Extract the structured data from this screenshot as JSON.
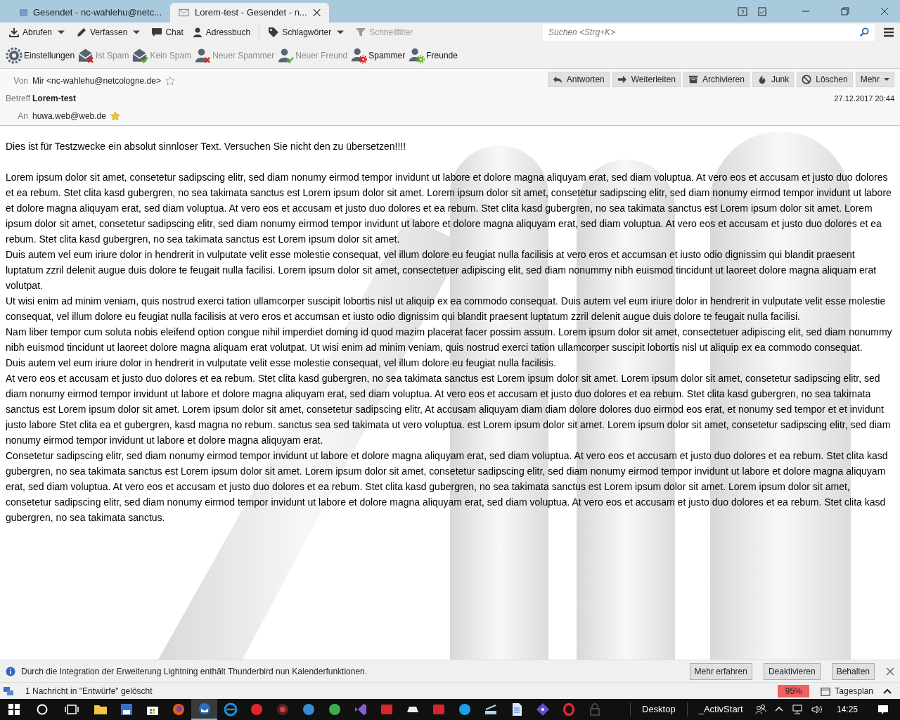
{
  "tabs": [
    {
      "label": "Gesendet - nc-wahlehu@netc...",
      "selected": false,
      "kind": "folder"
    },
    {
      "label": "Lorem-test - Gesendet - n...",
      "selected": true,
      "kind": "message"
    }
  ],
  "main_toolbar": [
    {
      "label": "Abrufen",
      "kind": "download",
      "dropdown": true,
      "disabled": false
    },
    {
      "label": "Verfassen",
      "kind": "pencil",
      "dropdown": true,
      "disabled": false
    },
    {
      "label": "Chat",
      "kind": "chat",
      "dropdown": false,
      "disabled": false
    },
    {
      "label": "Adressbuch",
      "kind": "person",
      "dropdown": false,
      "disabled": false
    },
    {
      "label": "Schlagwörter",
      "kind": "tag",
      "dropdown": true,
      "disabled": false
    },
    {
      "label": "Schnellfilter",
      "kind": "filter",
      "dropdown": false,
      "disabled": true
    }
  ],
  "search": {
    "placeholder": "Suchen <Strg+K>"
  },
  "spam_toolbar": [
    {
      "label": "Einstellungen",
      "kind": "gear",
      "disabled": false
    },
    {
      "label": "Ist Spam",
      "kind": "mail-x",
      "disabled": true
    },
    {
      "label": "Kein Spam",
      "kind": "mail-check",
      "disabled": true
    },
    {
      "label": "Neuer Spammer",
      "kind": "person-x",
      "disabled": true
    },
    {
      "label": "Neuer Freund",
      "kind": "person-check",
      "disabled": true
    },
    {
      "label": "Spammer",
      "kind": "person-gear-red",
      "disabled": false
    },
    {
      "label": "Freunde",
      "kind": "person-gear-green",
      "disabled": false
    }
  ],
  "header": {
    "from_label": "Von",
    "from": "Mir <nc-wahlehu@netcologne.de>",
    "from_starred": false,
    "subject_label": "Betreff",
    "subject": "Lorem-test",
    "to_label": "An",
    "to": "huwa.web@web.de",
    "to_starred": true,
    "date": "27.12.2017 20:44",
    "actions": [
      {
        "label": "Antworten",
        "kind": "reply"
      },
      {
        "label": "Weiterleiten",
        "kind": "forward"
      },
      {
        "label": "Archivieren",
        "kind": "archive"
      },
      {
        "label": "Junk",
        "kind": "junk"
      },
      {
        "label": "Löschen",
        "kind": "delete"
      },
      {
        "label": "Mehr",
        "kind": "more"
      }
    ]
  },
  "body": {
    "intro": "Dies ist für Testzwecke ein absolut sinnloser Text. Versuchen Sie nicht den zu übersetzen!!!!",
    "paragraphs": [
      "Lorem ipsum dolor sit amet, consetetur sadipscing elitr, sed diam nonumy eirmod tempor invidunt ut labore et dolore magna aliquyam erat, sed diam voluptua. At vero eos et accusam et justo duo dolores et ea rebum. Stet clita kasd gubergren, no sea takimata sanctus est Lorem ipsum dolor sit amet. Lorem ipsum dolor sit amet, consetetur sadipscing elitr, sed diam nonumy eirmod tempor invidunt ut labore et dolore magna aliquyam erat, sed diam voluptua. At vero eos et accusam et justo duo dolores et ea rebum. Stet clita kasd gubergren, no sea takimata sanctus est Lorem ipsum dolor sit amet. Lorem ipsum dolor sit amet, consetetur sadipscing elitr, sed diam nonumy eirmod tempor invidunt ut labore et dolore magna aliquyam erat, sed diam voluptua. At vero eos et accusam et justo duo dolores et ea rebum. Stet clita kasd gubergren, no sea takimata sanctus est Lorem ipsum dolor sit amet.",
      "Duis autem vel eum iriure dolor in hendrerit in vulputate velit esse molestie consequat, vel illum dolore eu feugiat nulla facilisis at vero eros et accumsan et iusto odio dignissim qui blandit praesent luptatum zzril delenit augue duis dolore te feugait nulla facilisi. Lorem ipsum dolor sit amet, consectetuer adipiscing elit, sed diam nonummy nibh euismod tincidunt ut laoreet dolore magna aliquam erat volutpat.",
      "Ut wisi enim ad minim veniam, quis nostrud exerci tation ullamcorper suscipit lobortis nisl ut aliquip ex ea commodo consequat. Duis autem vel eum iriure dolor in hendrerit in vulputate velit esse molestie consequat, vel illum dolore eu feugiat nulla facilisis at vero eros et accumsan et iusto odio dignissim qui blandit praesent luptatum zzril delenit augue duis dolore te feugait nulla facilisi.",
      "Nam liber tempor cum soluta nobis eleifend option congue nihil imperdiet doming id quod mazim placerat facer possim assum. Lorem ipsum dolor sit amet, consectetuer adipiscing elit, sed diam nonummy nibh euismod tincidunt ut laoreet dolore magna aliquam erat volutpat. Ut wisi enim ad minim veniam, quis nostrud exerci tation ullamcorper suscipit lobortis nisl ut aliquip ex ea commodo consequat.",
      "Duis autem vel eum iriure dolor in hendrerit in vulputate velit esse molestie consequat, vel illum dolore eu feugiat nulla facilisis.",
      "At vero eos et accusam et justo duo dolores et ea rebum. Stet clita kasd gubergren, no sea takimata sanctus est Lorem ipsum dolor sit amet. Lorem ipsum dolor sit amet, consetetur sadipscing elitr, sed diam nonumy eirmod tempor invidunt ut labore et dolore magna aliquyam erat, sed diam voluptua. At vero eos et accusam et justo duo dolores et ea rebum. Stet clita kasd gubergren, no sea takimata sanctus est Lorem ipsum dolor sit amet. Lorem ipsum dolor sit amet, consetetur sadipscing elitr, At accusam aliquyam diam diam dolore dolores duo eirmod eos erat, et nonumy sed tempor et et invidunt justo labore Stet clita ea et gubergren, kasd magna no rebum. sanctus sea sed takimata ut vero voluptua. est Lorem ipsum dolor sit amet. Lorem ipsum dolor sit amet, consetetur sadipscing elitr, sed diam nonumy eirmod tempor invidunt ut labore et dolore magna aliquyam erat.",
      "Consetetur sadipscing elitr, sed diam nonumy eirmod tempor invidunt ut labore et dolore magna aliquyam erat, sed diam voluptua. At vero eos et accusam et justo duo dolores et ea rebum. Stet clita kasd gubergren, no sea takimata sanctus est Lorem ipsum dolor sit amet. Lorem ipsum dolor sit amet, consetetur sadipscing elitr, sed diam nonumy eirmod tempor invidunt ut labore et dolore magna aliquyam erat, sed diam voluptua. At vero eos et accusam et justo duo dolores et ea rebum. Stet clita kasd gubergren, no sea takimata sanctus est Lorem ipsum dolor sit amet. Lorem ipsum dolor sit amet, consetetur sadipscing elitr, sed diam nonumy eirmod tempor invidunt ut labore et dolore magna aliquyam erat, sed diam voluptua. At vero eos et accusam et justo duo dolores et ea rebum. Stet clita kasd gubergren, no sea takimata sanctus."
    ]
  },
  "notification": {
    "text": "Durch die Integration der Erweiterung Lightning enthält Thunderbird nun Kalenderfunktionen.",
    "buttons": [
      "Mehr erfahren",
      "Deaktivieren",
      "Behalten"
    ]
  },
  "status_bar": {
    "message": "1 Nachricht in \"Entwürfe\" gelöscht",
    "zoom": "95%",
    "today_pane": "Tagesplan"
  },
  "taskbar": {
    "items": [
      {
        "kind": "folder",
        "active": false
      },
      {
        "kind": "disk",
        "active": false
      },
      {
        "kind": "store",
        "active": false
      },
      {
        "kind": "firefox",
        "active": false
      },
      {
        "kind": "thunderbird",
        "active": true
      },
      {
        "kind": "edge",
        "active": false
      },
      {
        "kind": "red-circle",
        "active": false
      },
      {
        "kind": "dark-circle",
        "active": false
      },
      {
        "kind": "blue-circle",
        "active": false
      },
      {
        "kind": "green-circle",
        "active": false
      },
      {
        "kind": "vs",
        "active": false
      },
      {
        "kind": "red-square",
        "active": false
      },
      {
        "kind": "grey-shape",
        "active": false
      },
      {
        "kind": "red-square",
        "active": false
      },
      {
        "kind": "skype",
        "active": false
      },
      {
        "kind": "scanner",
        "active": false
      },
      {
        "kind": "document",
        "active": false
      },
      {
        "kind": "diamond",
        "active": false
      },
      {
        "kind": "opera",
        "active": false
      },
      {
        "kind": "lock",
        "active": false
      }
    ],
    "toolbars": [
      "Desktop",
      "_ActivStart"
    ],
    "time": "14:25"
  }
}
